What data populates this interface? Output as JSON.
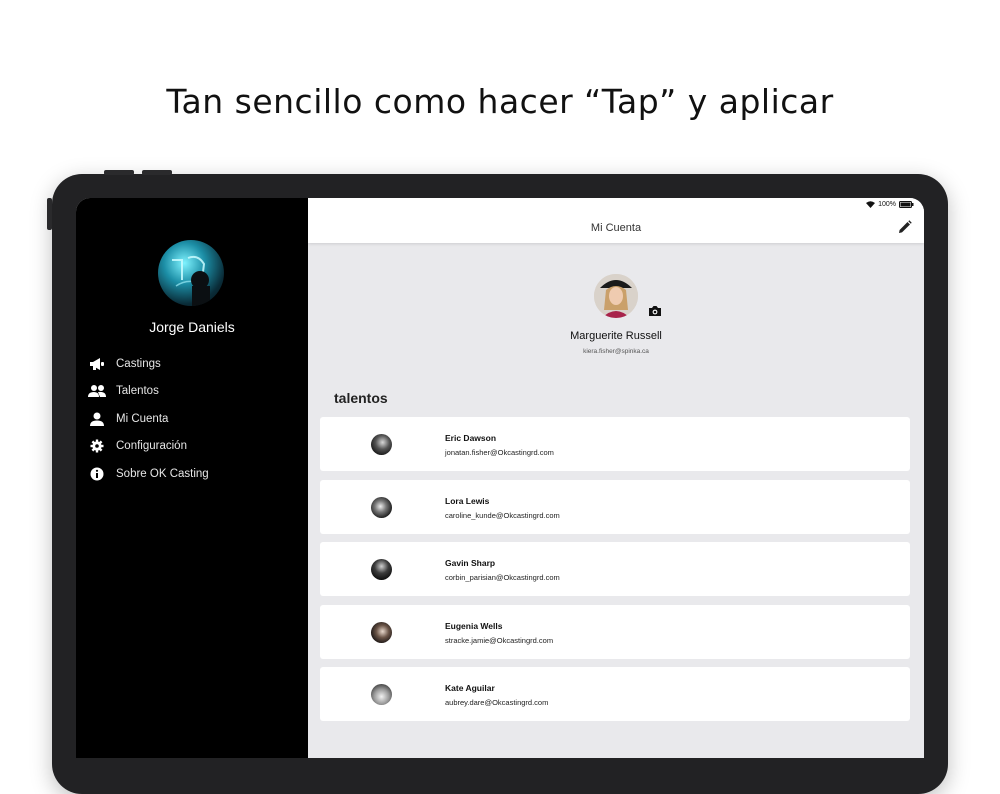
{
  "headline": "Tan sencillo como hacer “Tap” y aplicar",
  "sidebar": {
    "user_name": "Jorge Daniels",
    "items": [
      {
        "label": "Castings",
        "icon": "megaphone-icon"
      },
      {
        "label": "Talentos",
        "icon": "users-icon"
      },
      {
        "label": "Mi Cuenta",
        "icon": "user-icon"
      },
      {
        "label": "Configuración",
        "icon": "gear-icon"
      },
      {
        "label": "Sobre OK Casting",
        "icon": "info-icon"
      }
    ]
  },
  "status_bar": {
    "battery": "100%"
  },
  "topbar": {
    "title": "Mi Cuenta",
    "edit_icon": "pencil-icon"
  },
  "profile": {
    "name": "Marguerite Russell",
    "email": "kiera.fisher@spinka.ca",
    "camera_icon": "camera-icon"
  },
  "talents_section": {
    "title": "talentos",
    "items": [
      {
        "name": "Eric Dawson",
        "email": "jonatan.fisher@Okcastingrd.com"
      },
      {
        "name": "Lora Lewis",
        "email": "caroline_kunde@Okcastingrd.com"
      },
      {
        "name": "Gavin Sharp",
        "email": "corbin_parisian@Okcastingrd.com"
      },
      {
        "name": "Eugenia Wells",
        "email": "stracke.jamie@Okcastingrd.com"
      },
      {
        "name": "Kate Aguilar",
        "email": "aubrey.dare@Okcastingrd.com"
      }
    ]
  },
  "colors": {
    "sidebar_bg": "#000000",
    "content_bg": "#e9e9ec",
    "card_bg": "#ffffff",
    "device_frame": "#222224"
  }
}
